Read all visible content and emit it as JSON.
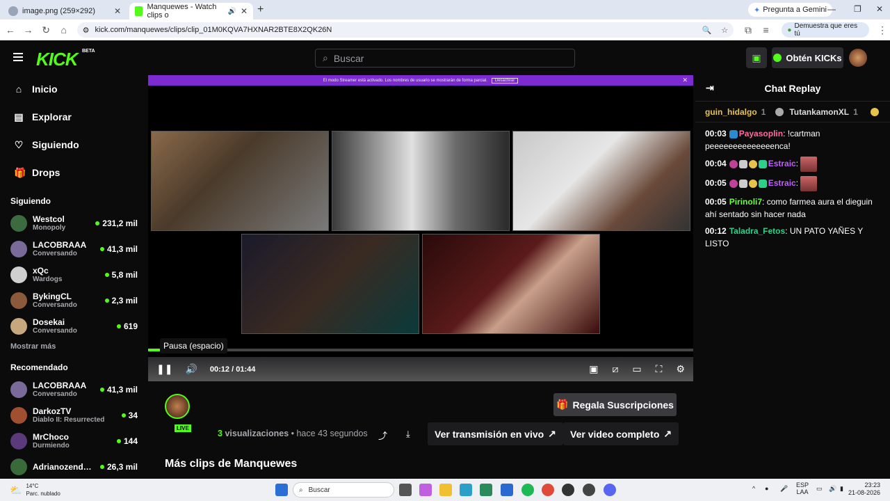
{
  "browser": {
    "tabs": [
      {
        "title": "image.png (259×292)",
        "active": false
      },
      {
        "title": "Manquewes - Watch clips o",
        "active": true
      }
    ],
    "gemini_label": "Pregunta a Gemini",
    "url": "kick.com/manquewes/clips/clip_01M0KQVA7HXNAR2BTE8X2QK26N",
    "verify_label": "Demuestra que eres tú"
  },
  "header": {
    "logo": "KICK",
    "beta": "BETA",
    "search_placeholder": "Buscar",
    "kicks_label": "Obtén KICKs"
  },
  "sidebar": {
    "nav": [
      {
        "label": "Inicio",
        "icon": "home-icon"
      },
      {
        "label": "Explorar",
        "icon": "browse-icon"
      },
      {
        "label": "Siguiendo",
        "icon": "heart-icon"
      },
      {
        "label": "Drops",
        "icon": "gift-icon"
      }
    ],
    "following_title": "Siguiendo",
    "following": [
      {
        "name": "Westcol",
        "category": "Monopoly",
        "viewers": "231,2 mil",
        "color": "#3b6b3e"
      },
      {
        "name": "LACOBRAAA",
        "category": "Conversando",
        "viewers": "41,3 mil",
        "color": "#7a6a9a"
      },
      {
        "name": "xQc",
        "category": "Wardogs",
        "viewers": "5,8 mil",
        "color": "#cfcfcf"
      },
      {
        "name": "BykingCL",
        "category": "Conversando",
        "viewers": "2,3 mil",
        "color": "#8a5a3a"
      },
      {
        "name": "Dosekai",
        "category": "Conversando",
        "viewers": "619",
        "color": "#c6a77e"
      }
    ],
    "show_more": "Mostrar más",
    "recommended_title": "Recomendado",
    "recommended": [
      {
        "name": "LACOBRAAA",
        "category": "Conversando",
        "viewers": "41,3 mil",
        "color": "#7a6a9a"
      },
      {
        "name": "DarkozTV",
        "category": "Diablo II: Resurrected",
        "viewers": "34",
        "color": "#a05030"
      },
      {
        "name": "MrChoco",
        "category": "Durmiendo",
        "viewers": "144",
        "color": "#5a3a7a"
      },
      {
        "name": "Adrianozendej...",
        "category": "",
        "viewers": "26,3 mil",
        "color": "#3a6a3a"
      }
    ]
  },
  "player": {
    "streamer_banner": "El modo Streamer está activado. Los nombres de usuario se mostrarán de forma parcial.",
    "streamer_banner_button": "Desactivar",
    "tooltip": "Pausa (espacio)",
    "current_time": "00:12",
    "duration": "01:44",
    "progress": 0.115
  },
  "clip": {
    "live_badge": "LIVE",
    "gift_button": "Regala Suscripciones",
    "views_count": "3",
    "views_label": "visualizaciones",
    "time_ago": "hace 43 segundos",
    "watch_live": "Ver transmisión en vivo",
    "watch_full": "Ver video completo",
    "more_clips": "Más clips de Manquewes"
  },
  "chat": {
    "title": "Chat Replay",
    "gifters": [
      {
        "name": "guin_hidalgo",
        "count": "1"
      },
      {
        "name": "TutankamonXL",
        "count": "1"
      }
    ],
    "messages": [
      {
        "time": "00:03",
        "user": "Payasoplin",
        "color": "#ff6b9e",
        "text": "!cartman peeeeeeeeeeeeeenca!"
      },
      {
        "time": "00:04",
        "user": "Estraic",
        "color": "#c05cff",
        "text": ""
      },
      {
        "time": "00:05",
        "user": "Estraic",
        "color": "#c05cff",
        "text": ""
      },
      {
        "time": "00:05",
        "user": "Pirinoli7",
        "color": "#6bff3b",
        "text": "como farmea aura el dieguin ahí sentado sin hacer nada"
      },
      {
        "time": "00:12",
        "user": "Taladra_Fetos",
        "color": "#2ecf8a",
        "text": "UN PATO YAÑES Y LISTO"
      }
    ]
  },
  "taskbar": {
    "temp": "14°C",
    "weather": "Parc. nublado",
    "search": "Buscar",
    "lang": "ESP",
    "lang2": "LAA",
    "time": "23:23",
    "date": "21-08-2026"
  }
}
